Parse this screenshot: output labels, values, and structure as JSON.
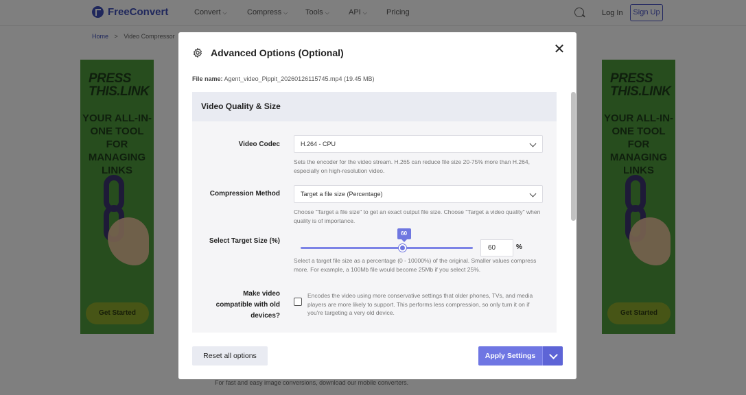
{
  "brand": {
    "name": "FreeConvert"
  },
  "nav": {
    "items": [
      {
        "label": "Convert",
        "chevron": true
      },
      {
        "label": "Compress",
        "chevron": true
      },
      {
        "label": "Tools",
        "chevron": true
      },
      {
        "label": "API",
        "chevron": true
      },
      {
        "label": "Pricing",
        "chevron": false
      }
    ],
    "login": "Log In",
    "signup": "Sign Up"
  },
  "breadcrumb": {
    "home": "Home",
    "separator": ">",
    "current": "Video Compressor"
  },
  "ads": {
    "headline_1": "PRESS",
    "headline_2": "THIS.LINK",
    "sub": "YOUR ALL-IN-ONE TOOL FOR MANAGING LINKS",
    "cta": "Get Started"
  },
  "background_footer": "For fast and easy image conversions, download our mobile converters.",
  "modal": {
    "title": "Advanced Options (Optional)",
    "file_label": "File name:",
    "file_value": "Agent_video_Pippit_20260126115745.mp4 (19.45 MB)",
    "section_title": "Video Quality & Size",
    "video_codec": {
      "label": "Video Codec",
      "value": "H.264 - CPU",
      "help": "Sets the encoder for the video stream. H.265 can reduce file size 20-75% more than H.264, especially on high-resolution video."
    },
    "compression_method": {
      "label": "Compression Method",
      "value": "Target a file size (Percentage)",
      "help": "Choose \"Target a file size\" to get an exact output file size. Choose \"Target a video quality\" when quality is of importance."
    },
    "target_size": {
      "label": "Select Target Size (%)",
      "value": 60,
      "value_text": "60",
      "unit": "%",
      "slider_fraction": 0.6,
      "help": "Select a target file size as a percentage (0 - 10000%) of the original. Smaller values compress more. For example, a 100Mb file would become 25Mb if you select 25%."
    },
    "compatibility": {
      "label": "Make video compatible with old devices?",
      "checked": false,
      "help": "Encodes the video using more conservative settings that older phones, TVs, and media players are more likely to support. This performs less compression, so only turn it on if you're targeting a very old device."
    },
    "reset_label": "Reset all options",
    "apply_label": "Apply Settings"
  },
  "colors": {
    "accent": "#6f76e3",
    "brand": "#3f4fb8",
    "section_bg": "#e9ebf2",
    "ad_green": "#4e9a3c"
  },
  "icons": {
    "logo": "logo-icon",
    "search": "search-icon",
    "settings": "gear-icon",
    "close": "close-icon",
    "dropdown": "chevron-down-icon"
  }
}
